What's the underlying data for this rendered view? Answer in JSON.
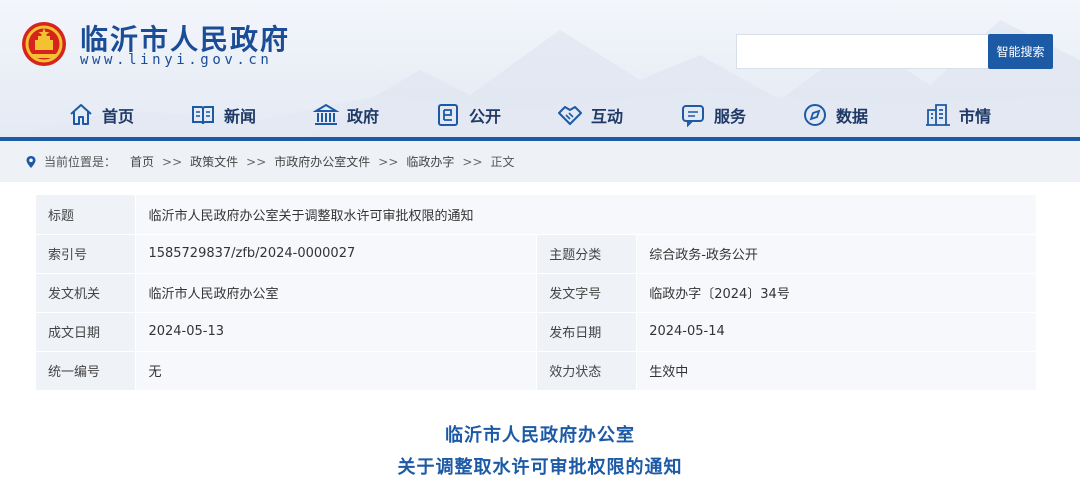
{
  "site": {
    "title": "临沂市人民政府",
    "url": "www.linyi.gov.cn"
  },
  "search": {
    "placeholder": "",
    "button_label": "智能搜索"
  },
  "nav": [
    {
      "label": "首页",
      "icon": "home-icon"
    },
    {
      "label": "新闻",
      "icon": "newspaper-icon"
    },
    {
      "label": "政府",
      "icon": "government-building-icon"
    },
    {
      "label": "公开",
      "icon": "public-info-icon"
    },
    {
      "label": "互动",
      "icon": "handshake-icon"
    },
    {
      "label": "服务",
      "icon": "service-chat-icon"
    },
    {
      "label": "数据",
      "icon": "data-compass-icon"
    },
    {
      "label": "市情",
      "icon": "city-building-icon"
    }
  ],
  "breadcrumb": {
    "label": "当前位置是：",
    "separator": ">>",
    "items": [
      "首页",
      "政策文件",
      "市政府办公室文件",
      "临政办字",
      "正文"
    ]
  },
  "meta": {
    "title_key": "标题",
    "title_value": "临沂市人民政府办公室关于调整取水许可审批权限的通知",
    "rows": [
      {
        "k1": "索引号",
        "v1": "1585729837/zfb/2024-0000027",
        "k2": "主题分类",
        "v2": "综合政务-政务公开"
      },
      {
        "k1": "发文机关",
        "v1": "临沂市人民政府办公室",
        "k2": "发文字号",
        "v2": "临政办字〔2024〕34号"
      },
      {
        "k1": "成文日期",
        "v1": "2024-05-13",
        "k2": "发布日期",
        "v2": "2024-05-14"
      },
      {
        "k1": "统一编号",
        "v1": "无",
        "k2": "效力状态",
        "v2": "生效中"
      }
    ]
  },
  "document": {
    "title_line1": "临沂市人民政府办公室",
    "title_line2": "关于调整取水许可审批权限的通知"
  },
  "colors": {
    "brand_blue": "#1c5aa6",
    "title_blue": "#1a4c97",
    "emblem_red": "#d6231d",
    "emblem_gold": "#f2c230"
  }
}
